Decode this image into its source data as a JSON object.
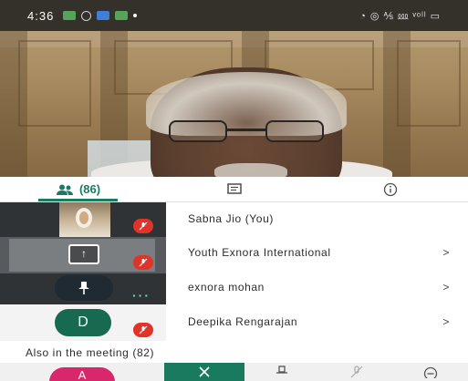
{
  "status_bar": {
    "time": "4:36",
    "right_text": "◔ ◎ ⅍ ⅏ ᵛᵒˡˡ ▭"
  },
  "tabs": {
    "people_count": "(86)",
    "people_icon": "people-icon",
    "chat_icon": "chat-icon",
    "info_icon": "info-icon"
  },
  "tiles": {
    "avatar_letter": "D",
    "present_icon": "present-to-all-icon",
    "pin_icon": "pin-icon",
    "more_icon": "more-dots-icon",
    "mute_icon": "mic-off-icon"
  },
  "participants": [
    {
      "name": "Sabna Jio (You)",
      "chevron": ""
    },
    {
      "name": "Youth Exnora International",
      "chevron": ">"
    },
    {
      "name": "exnora mohan",
      "chevron": ">"
    },
    {
      "name": "Deepika Rengarajan",
      "chevron": ">"
    }
  ],
  "also_in_meeting": "Also in the meeting (82)",
  "toolbar": {
    "profile_letter": "A",
    "close_icon": "close-icon",
    "pin_icon": "pin-icon",
    "mic_off_icon": "mic-off-icon",
    "more_icon": "more-icon"
  },
  "colors": {
    "accent": "#1b7a64",
    "mute": "#e0332a",
    "profile": "#d8276b"
  }
}
